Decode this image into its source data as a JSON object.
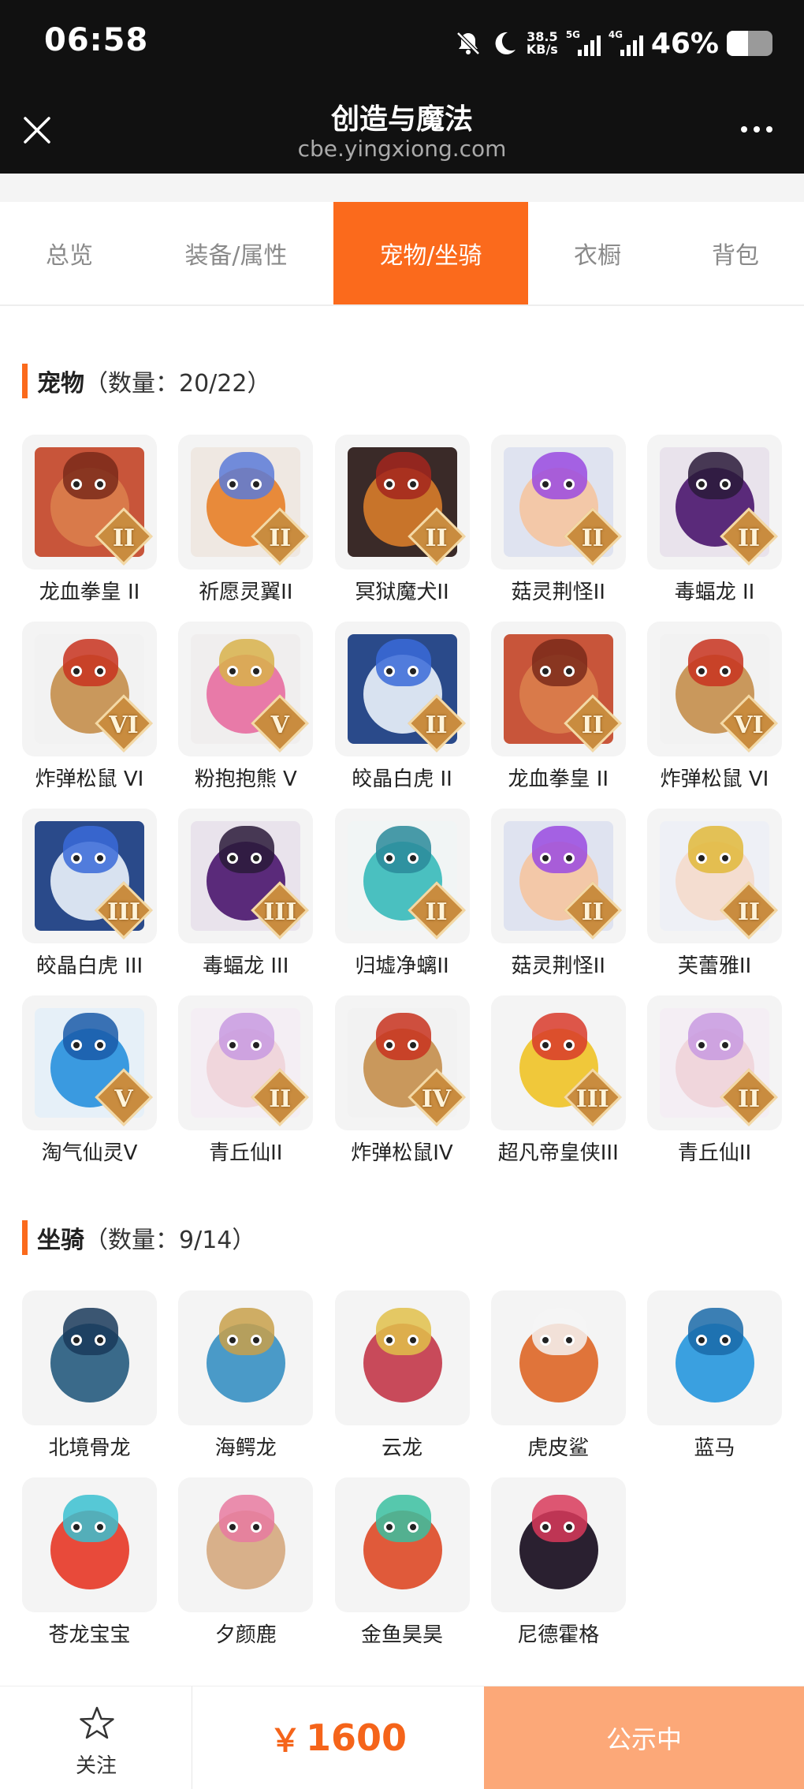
{
  "status_bar": {
    "time": "06:58",
    "net_speed": "38.5",
    "net_unit": "KB/s",
    "sig1_label": "5G",
    "sig2_label": "4G",
    "battery_pct": "46%",
    "battery_level": 0.46
  },
  "header": {
    "title": "创造与魔法",
    "url": "cbe.yingxiong.com"
  },
  "tabs": [
    "总览",
    "装备/属性",
    "宠物/坐骑",
    "衣橱",
    "背包"
  ],
  "active_tab": 2,
  "pets": {
    "title": "宠物",
    "count": "（数量：20/22）",
    "items": [
      {
        "name": "龙血拳皇 II",
        "badge": "II",
        "bg": "#c8553a",
        "color": "#d97a4a",
        "accent": "#7a2a1a"
      },
      {
        "name": "祈愿灵翼II",
        "badge": "II",
        "bg": "#efe8e2",
        "color": "#e88a3a",
        "accent": "#5a7ad8"
      },
      {
        "name": "冥狱魔犬II",
        "badge": "II",
        "bg": "#3a2a28",
        "color": "#c8742a",
        "accent": "#a3261d"
      },
      {
        "name": "菇灵荆怪II",
        "badge": "II",
        "bg": "#dfe3f0",
        "color": "#f3c8a8",
        "accent": "#9a4ae0"
      },
      {
        "name": "毒蝠龙 II",
        "badge": "II",
        "bg": "#e9e3ec",
        "color": "#5a2a7a",
        "accent": "#2a1a3a"
      },
      {
        "name": "炸弹松鼠 VI",
        "badge": "VI",
        "bg": "#f2f2f2",
        "color": "#c9985c",
        "accent": "#c8321e"
      },
      {
        "name": "粉抱抱熊 V",
        "badge": "V",
        "bg": "#f0eeee",
        "color": "#e87aa8",
        "accent": "#d8b24a"
      },
      {
        "name": "皎晶白虎 II",
        "badge": "II",
        "bg": "#2a4a8a",
        "color": "#d8e2f0",
        "accent": "#3a6ad8"
      },
      {
        "name": "龙血拳皇 II",
        "badge": "II",
        "bg": "#c8553a",
        "color": "#d97a4a",
        "accent": "#7a2a1a"
      },
      {
        "name": "炸弹松鼠 VI",
        "badge": "VI",
        "bg": "#f2f2f2",
        "color": "#c9985c",
        "accent": "#c8321e"
      },
      {
        "name": "皎晶白虎 III",
        "badge": "III",
        "bg": "#2a4a8a",
        "color": "#d8e2f0",
        "accent": "#3a6ad8"
      },
      {
        "name": "毒蝠龙 III",
        "badge": "III",
        "bg": "#e9e3ec",
        "color": "#5a2a7a",
        "accent": "#2a1a3a"
      },
      {
        "name": "归墟净螭II",
        "badge": "II",
        "bg": "#f1f5f5",
        "color": "#4ac0c0",
        "accent": "#2a8a9a"
      },
      {
        "name": "菇灵荆怪II",
        "badge": "II",
        "bg": "#dfe3f0",
        "color": "#f3c8a8",
        "accent": "#9a4ae0"
      },
      {
        "name": "芙蕾雅II",
        "badge": "II",
        "bg": "#eef0f6",
        "color": "#f4ddd0",
        "accent": "#e0b83a"
      },
      {
        "name": "淘气仙灵V",
        "badge": "V",
        "bg": "#e6f0f8",
        "color": "#3a9ae0",
        "accent": "#1a5aa8"
      },
      {
        "name": "青丘仙II",
        "badge": "II",
        "bg": "#f4eef4",
        "color": "#f0d6dc",
        "accent": "#c89ae0"
      },
      {
        "name": "炸弹松鼠IV",
        "badge": "IV",
        "bg": "#f2f2f2",
        "color": "#c9985c",
        "accent": "#c8321e"
      },
      {
        "name": "超凡帝皇侠III",
        "badge": "III",
        "bg": "#f4f4f4",
        "color": "#f0c83a",
        "accent": "#d83a2a"
      },
      {
        "name": "青丘仙II",
        "badge": "II",
        "bg": "#f4eef4",
        "color": "#f0d6dc",
        "accent": "#c89ae0"
      }
    ]
  },
  "mounts": {
    "title": "坐骑",
    "count": "（数量：9/14）",
    "items": [
      {
        "name": "北境骨龙",
        "bg": "#f4f4f4",
        "color": "#3a6a8a",
        "accent": "#1a3a5a"
      },
      {
        "name": "海鳄龙",
        "bg": "#f4f4f4",
        "color": "#4a9ac8",
        "accent": "#c8a04a"
      },
      {
        "name": "云龙",
        "bg": "#f4f4f4",
        "color": "#c84a5a",
        "accent": "#e0c04a"
      },
      {
        "name": "虎皮鲨",
        "bg": "#f4f4f4",
        "color": "#e0743a",
        "accent": "#f4f4f4"
      },
      {
        "name": "蓝马",
        "bg": "#f4f4f4",
        "color": "#3aa0e0",
        "accent": "#1a6aa8"
      },
      {
        "name": "苍龙宝宝",
        "bg": "#f4f4f4",
        "color": "#e84a3a",
        "accent": "#3ac0d0"
      },
      {
        "name": "夕颜鹿",
        "bg": "#f4f4f4",
        "color": "#d8b08a",
        "accent": "#e87aa0"
      },
      {
        "name": "金鱼昊昊",
        "bg": "#f4f4f4",
        "color": "#e05a3a",
        "accent": "#3ac0a0"
      },
      {
        "name": "尼德霍格",
        "bg": "#f4f4f4",
        "color": "#2a2030",
        "accent": "#d83a5a"
      }
    ]
  },
  "bottom": {
    "follow_label": "关注",
    "currency": "￥",
    "price": "1600",
    "status_label": "公示中"
  },
  "colors": {
    "accent": "#fb6a1c",
    "price": "#f5641a",
    "status_bg": "#fca878",
    "header_bg": "#111111"
  }
}
